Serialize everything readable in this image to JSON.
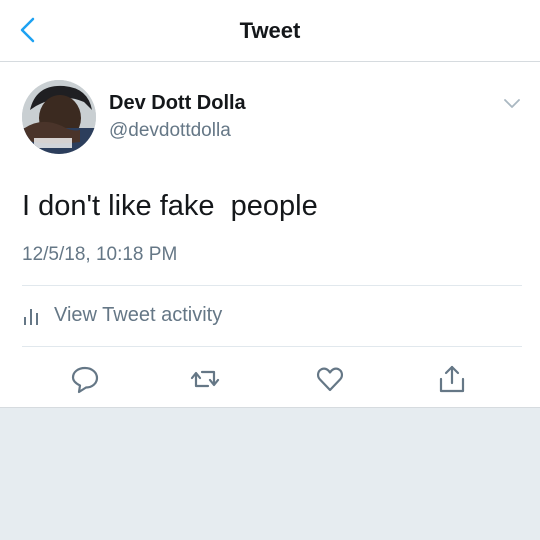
{
  "nav": {
    "title": "Tweet",
    "back_icon": "chevron-left-icon"
  },
  "tweet": {
    "author": {
      "display_name": "Dev Dott Dolla",
      "handle": "@devdottdolla"
    },
    "text": "I don't like fake  people",
    "timestamp": "12/5/18, 10:18 PM",
    "activity_label": "View Tweet activity"
  },
  "actions": [
    "reply-icon",
    "retweet-icon",
    "like-icon",
    "share-icon"
  ],
  "colors": {
    "accent": "#1da1f2",
    "text_primary": "#14171a",
    "text_secondary": "#657786",
    "background": "#e6ecf0"
  }
}
